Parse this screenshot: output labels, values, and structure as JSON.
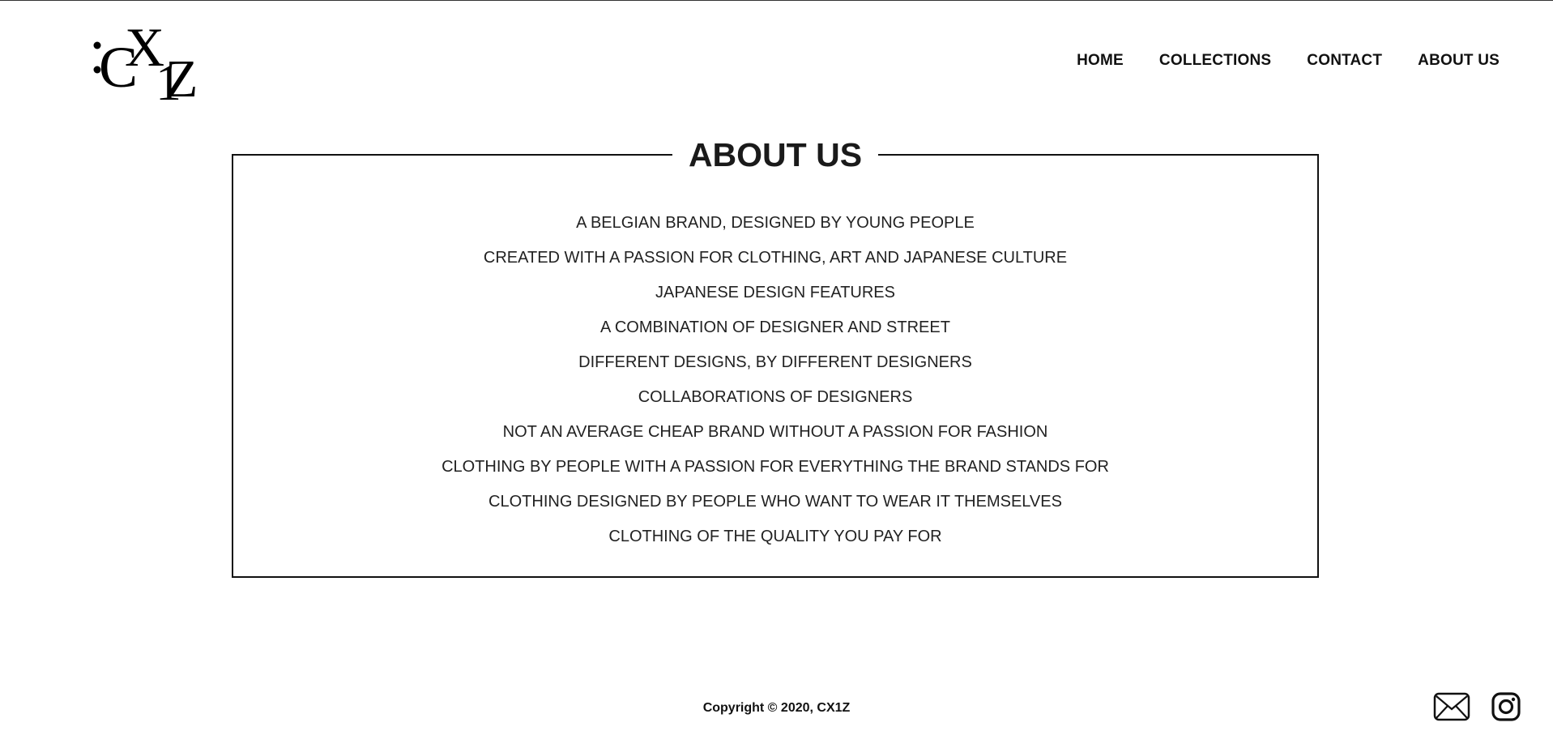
{
  "header": {
    "logo_icon": "cx1z-logo",
    "nav": [
      {
        "label": "HOME"
      },
      {
        "label": "COLLECTIONS"
      },
      {
        "label": "CONTACT"
      },
      {
        "label": "ABOUT US"
      }
    ]
  },
  "about": {
    "title": "ABOUT US",
    "items": [
      "A BELGIAN BRAND, DESIGNED BY YOUNG PEOPLE",
      "CREATED WITH A PASSION FOR CLOTHING, ART AND JAPANESE CULTURE",
      "JAPANESE DESIGN FEATURES",
      "A COMBINATION OF DESIGNER AND STREET",
      "DIFFERENT DESIGNS, BY DIFFERENT DESIGNERS",
      "COLLABORATIONS OF DESIGNERS",
      "NOT AN AVERAGE CHEAP BRAND WITHOUT A PASSION FOR FASHION",
      "CLOTHING BY PEOPLE WITH A PASSION FOR EVERYTHING THE BRAND STANDS FOR",
      "CLOTHING DESIGNED BY PEOPLE WHO WANT TO WEAR IT THEMSELVES",
      "CLOTHING OF THE QUALITY YOU PAY FOR"
    ]
  },
  "footer": {
    "copyright": "Copyright © 2020, CX1Z",
    "social_icons": [
      "mail-icon",
      "instagram-icon"
    ]
  }
}
